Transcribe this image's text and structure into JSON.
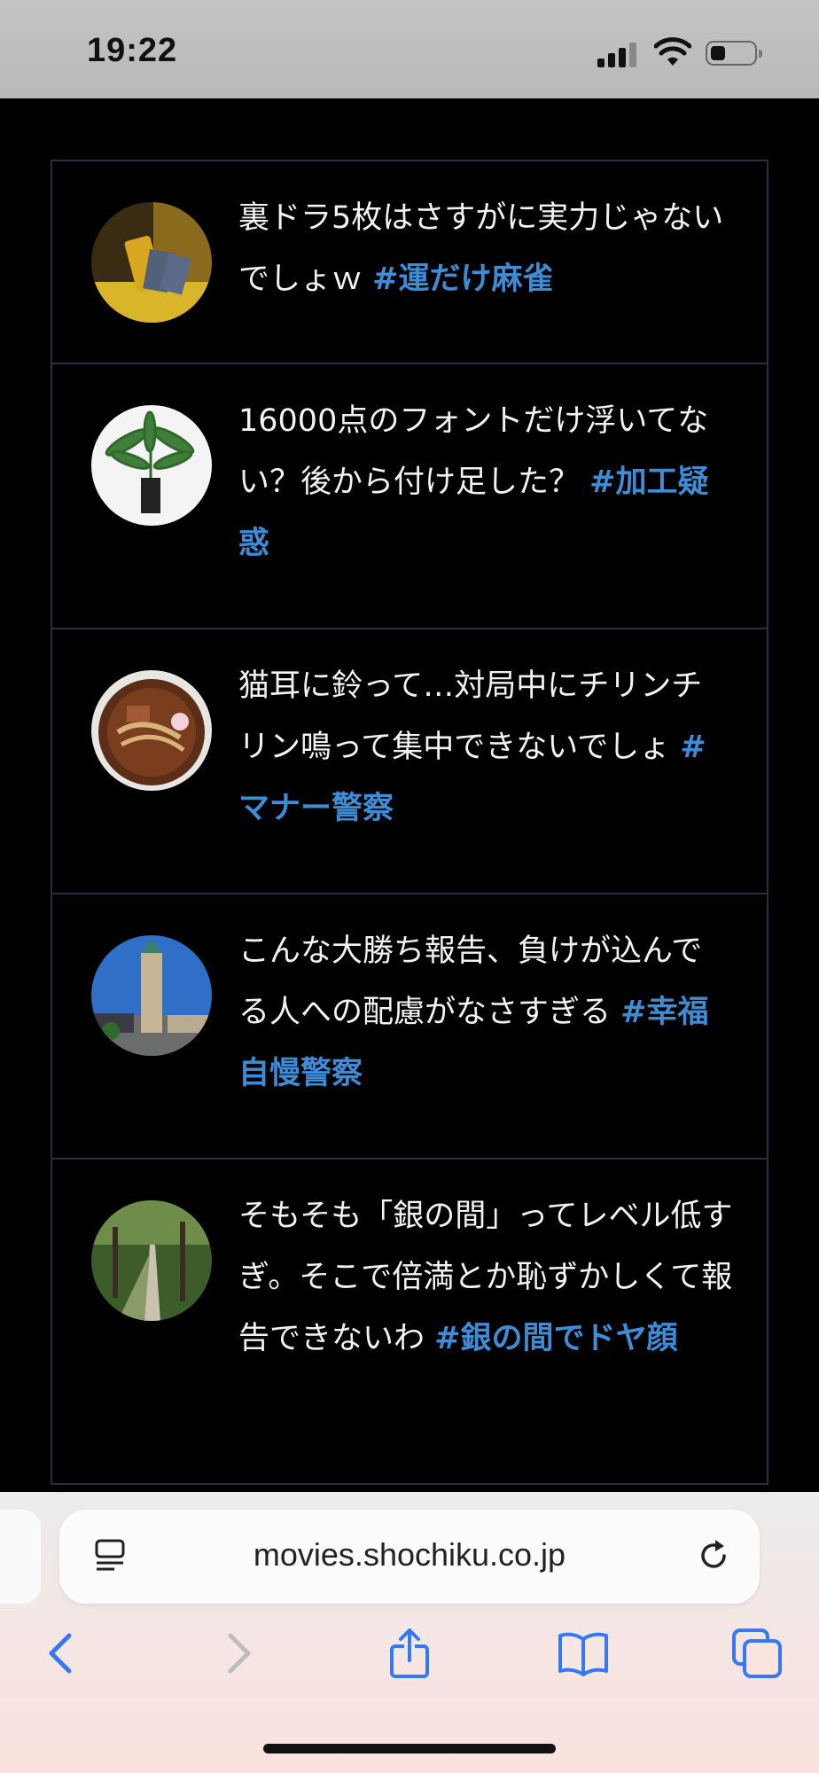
{
  "status_bar": {
    "time": "19:22",
    "signal": "signal-bars-icon",
    "wifi": "wifi-icon",
    "battery": "battery-icon"
  },
  "tweets": [
    {
      "avatar": "avatar-hand-cards",
      "text": "裏ドラ5枚はさすがに実力じゃないでしょｗ ",
      "hashtag": "#運だけ麻雀"
    },
    {
      "avatar": "avatar-potted-plant",
      "text": "16000点のフォントだけ浮いてない？後から付け足した？ ",
      "hashtag": "#加工疑惑"
    },
    {
      "avatar": "avatar-ramen-bowl",
      "text": "猫耳に鈴って…対局中にチリンチリン鳴って集中できないでしょ ",
      "hashtag": "#マナー警察"
    },
    {
      "avatar": "avatar-clock-tower",
      "text": "こんな大勝ち報告、負けが込んでる人への配慮がなさすぎる ",
      "hashtag": "#幸福自慢警察"
    },
    {
      "avatar": "avatar-tree-path",
      "text": "そもそも「銀の間」ってレベル低すぎ。そこで倍満とか恥ずかしくて報告できないわ ",
      "hashtag": "#銀の間でドヤ顔"
    }
  ],
  "browser": {
    "url": "movies.shochiku.co.jp",
    "reader_icon": "reader-mode-icon",
    "reload_icon": "reload-icon",
    "toolbar": [
      "back-icon",
      "forward-icon",
      "share-icon",
      "bookmarks-icon",
      "tabs-icon"
    ],
    "accent": "#3478f6"
  },
  "colors": {
    "hashtag": "#3e8bd6",
    "border": "#263041",
    "background": "#000000"
  }
}
